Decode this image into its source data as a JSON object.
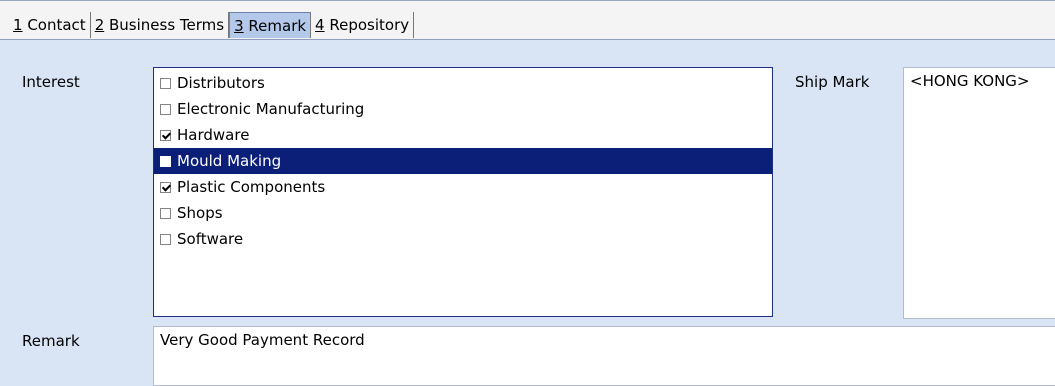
{
  "tabs": [
    {
      "mnemonic": "1",
      "label": " Contact"
    },
    {
      "mnemonic": "2",
      "label": " Business Terms"
    },
    {
      "mnemonic": "3",
      "label": " Remark"
    },
    {
      "mnemonic": "4",
      "label": " Repository"
    }
  ],
  "active_tab_index": 2,
  "interest": {
    "label": "Interest",
    "items": [
      {
        "label": "Distributors",
        "checked": false,
        "selected": false
      },
      {
        "label": "Electronic Manufacturing",
        "checked": false,
        "selected": false
      },
      {
        "label": "Hardware",
        "checked": true,
        "selected": false
      },
      {
        "label": "Mould Making",
        "checked": false,
        "selected": true
      },
      {
        "label": "Plastic Components",
        "checked": true,
        "selected": false
      },
      {
        "label": "Shops",
        "checked": false,
        "selected": false
      },
      {
        "label": "Software",
        "checked": false,
        "selected": false
      }
    ]
  },
  "ship_mark": {
    "label": "Ship Mark",
    "value": "<HONG KONG>"
  },
  "remark": {
    "label": "Remark",
    "value": "Very Good Payment Record"
  },
  "colors": {
    "selection_bg": "#0c1f78",
    "active_tab_bg": "#b4c8ea",
    "panel_bg": "#d9e4f5"
  }
}
